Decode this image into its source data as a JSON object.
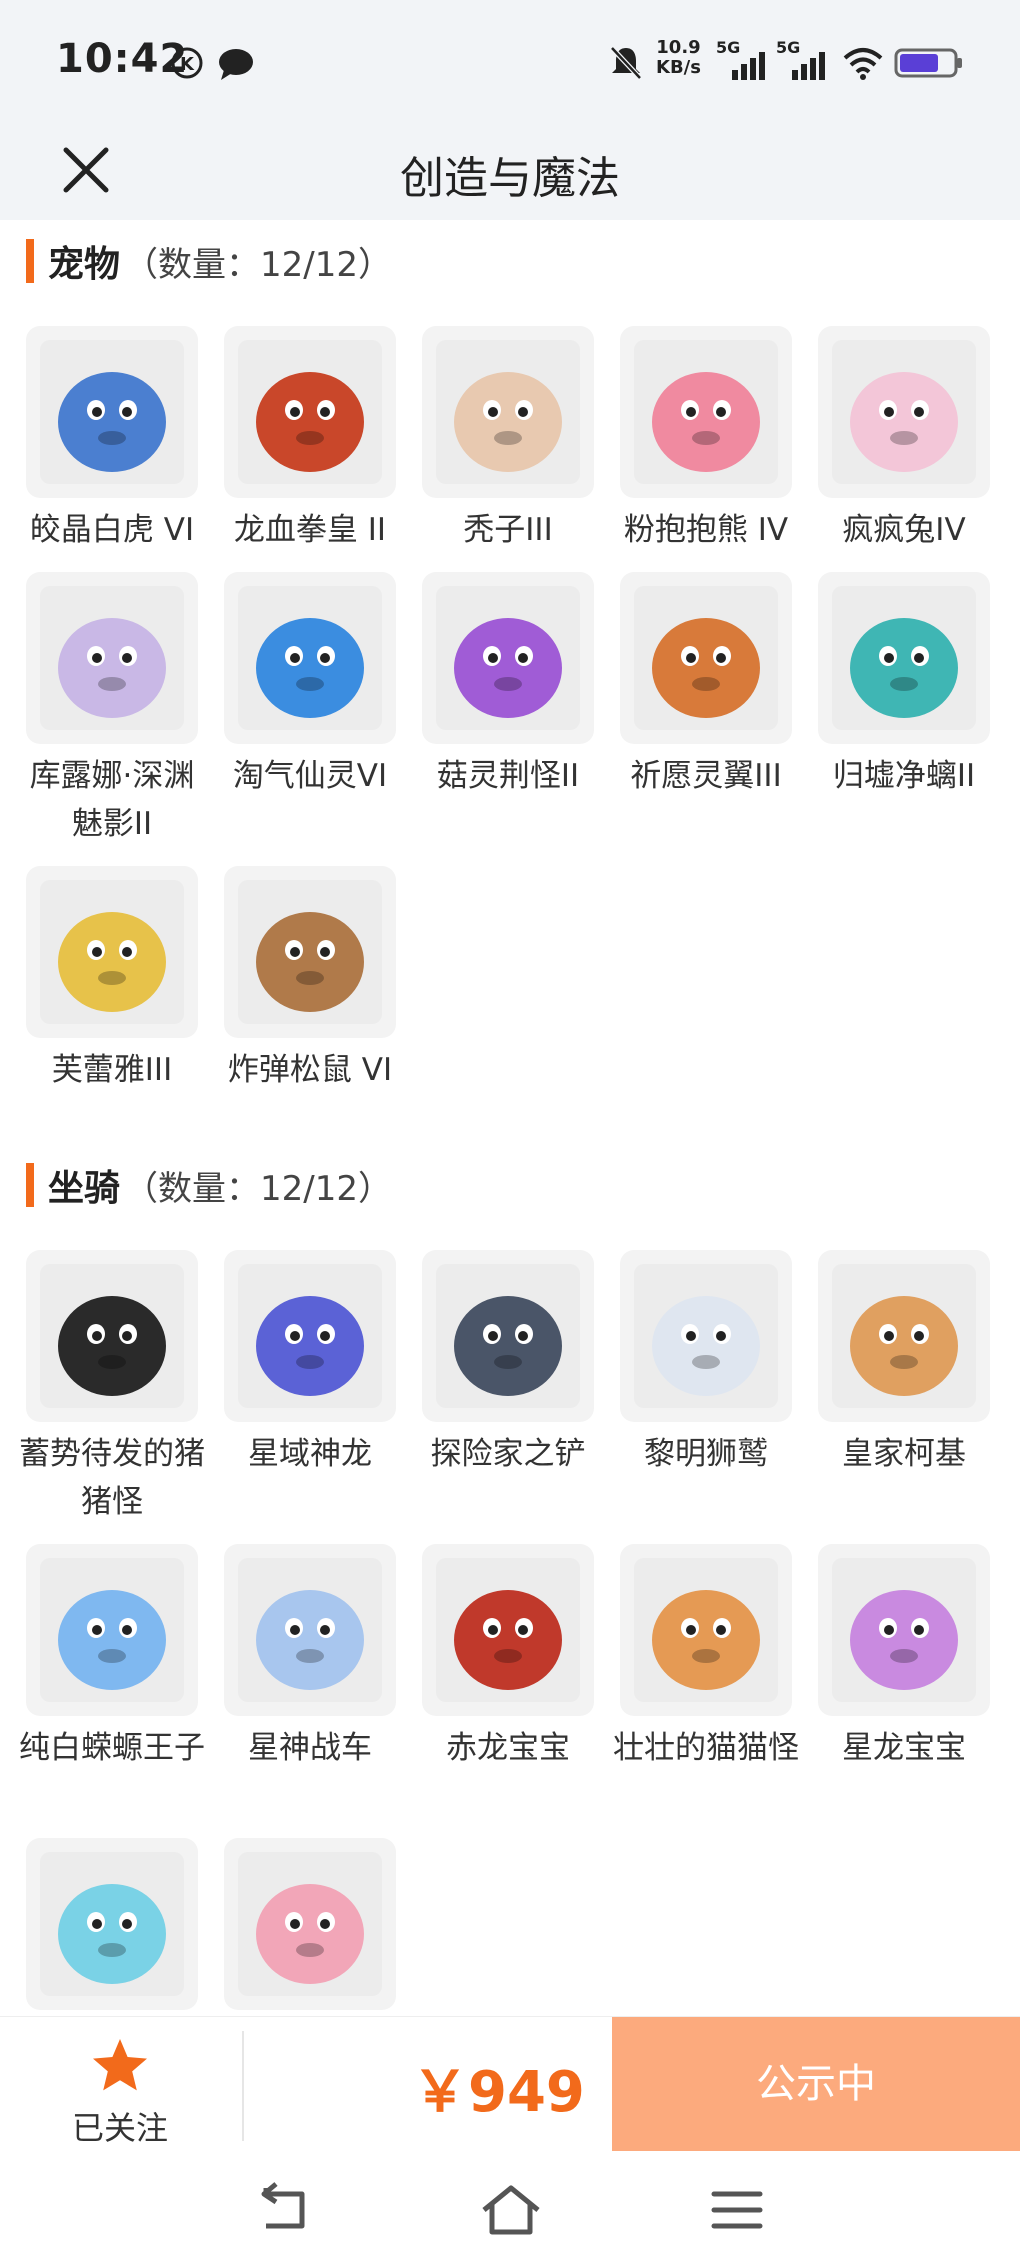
{
  "status_bar": {
    "time": "10:42",
    "net_speed_value": "10.9",
    "net_speed_unit": "KB/s",
    "signal_label_1": "5G",
    "signal_label_2": "5G"
  },
  "header": {
    "title": "创造与魔法"
  },
  "pets": {
    "name": "宠物",
    "count": "（数量：12/12）",
    "items": [
      {
        "label": "皎晶白虎 VI",
        "icon": "white-tiger-icon",
        "color": "#4b7fd0"
      },
      {
        "label": "龙血拳皇 II",
        "icon": "dragon-boxer-icon",
        "color": "#c9472a"
      },
      {
        "label": "秃子III",
        "icon": "bald-kid-icon",
        "color": "#e8c9b0"
      },
      {
        "label": "粉抱抱熊 IV",
        "icon": "pink-bear-icon",
        "color": "#f08aa0"
      },
      {
        "label": "疯疯兔IV",
        "icon": "crazy-rabbit-icon",
        "color": "#f3c6d8"
      },
      {
        "label": "库露娜·深渊魅影II",
        "icon": "kuluna-icon",
        "color": "#c9b8e6"
      },
      {
        "label": "淘气仙灵VI",
        "icon": "naughty-sprite-icon",
        "color": "#3b8de0"
      },
      {
        "label": "菇灵荆怪II",
        "icon": "mushroom-sprite-icon",
        "color": "#a05cd6"
      },
      {
        "label": "祈愿灵翼III",
        "icon": "wish-wing-icon",
        "color": "#d87a3a"
      },
      {
        "label": "归墟净螭II",
        "icon": "guixu-dragon-icon",
        "color": "#3fb6b4"
      },
      {
        "label": "芙蕾雅III",
        "icon": "freya-icon",
        "color": "#e7c24a"
      },
      {
        "label": "炸弹松鼠 VI",
        "icon": "bomb-squirrel-icon",
        "color": "#b07a4a"
      }
    ]
  },
  "mounts": {
    "name": "坐骑",
    "count": "（数量：12/12）",
    "items": [
      {
        "label": "蓄势待发的猪猪怪",
        "icon": "pig-monster-icon",
        "color": "#2a2a2a"
      },
      {
        "label": "星域神龙",
        "icon": "star-dragon-icon",
        "color": "#5b62d6"
      },
      {
        "label": "探险家之铲",
        "icon": "shovel-icon",
        "color": "#4a5568"
      },
      {
        "label": "黎明狮鹫",
        "icon": "griffin-icon",
        "color": "#dfe6f0"
      },
      {
        "label": "皇家柯基",
        "icon": "corgi-icon",
        "color": "#e0a060"
      },
      {
        "label": "纯白蝾螈王子",
        "icon": "axolotl-icon",
        "color": "#7fb8f0"
      },
      {
        "label": "星神战车",
        "icon": "star-chariot-icon",
        "color": "#a8c6ee"
      },
      {
        "label": "赤龙宝宝",
        "icon": "red-dragon-icon",
        "color": "#c0392b"
      },
      {
        "label": "壮壮的猫猫怪",
        "icon": "cat-monster-icon",
        "color": "#e59a54"
      },
      {
        "label": "星龙宝宝",
        "icon": "star-baby-dragon-icon",
        "color": "#c98ae0"
      },
      {
        "label": "",
        "icon": "skateboard-icon",
        "color": "#7ad2e6"
      },
      {
        "label": "",
        "icon": "pink-creature-icon",
        "color": "#f2a6b8"
      }
    ]
  },
  "bottom_bar": {
    "follow_label": "已关注",
    "price": "￥949",
    "status_button": "公示中",
    "accent_color": "#f26a1b"
  },
  "nav_bar": {
    "buttons": [
      "back-nav-icon",
      "home-nav-icon",
      "menu-nav-icon"
    ]
  }
}
